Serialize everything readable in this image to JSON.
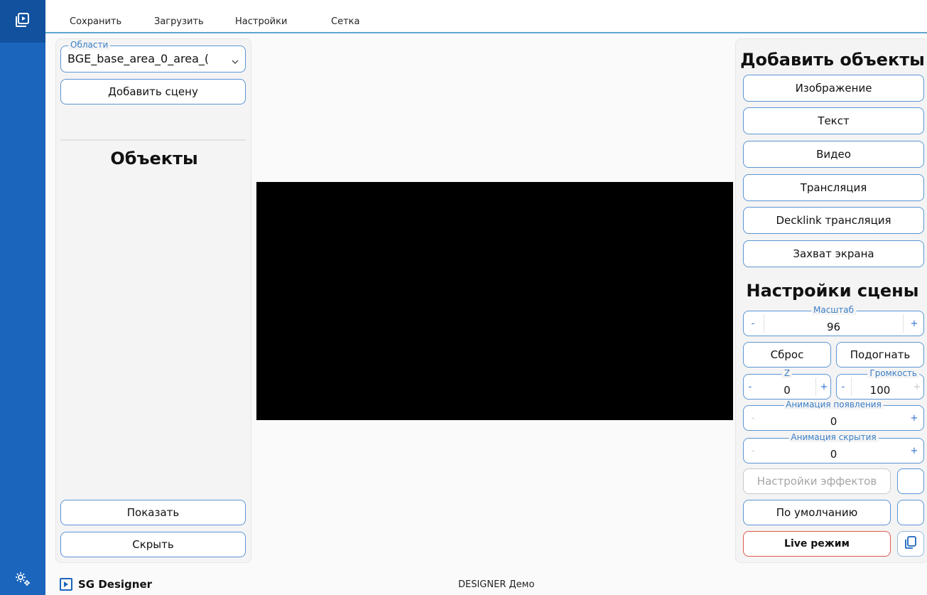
{
  "menu": {
    "save": "Сохранить",
    "load": "Загрузить",
    "settings": "Настройки",
    "grid": "Сетка"
  },
  "left_panel": {
    "areas_legend": "Области",
    "areas_value": "BGE_base_area_0_area_(",
    "add_scene": "Добавить сцену",
    "objects_title": "Объекты",
    "show": "Показать",
    "hide": "Скрыть"
  },
  "right_panel": {
    "add_objects_title": "Добавить объекты",
    "image": "Изображение",
    "text": "Текст",
    "video": "Видео",
    "stream": "Трансляция",
    "decklink": "Decklink трансляция",
    "screen_capture": "Захват экрана",
    "scene_settings_title": "Настройки сцены",
    "scale": {
      "legend": "Масштаб",
      "value": "96"
    },
    "reset": "Сброс",
    "fit": "Подогнать",
    "z": {
      "legend": "Z",
      "value": "0"
    },
    "volume": {
      "legend": "Громкость",
      "value": "100"
    },
    "anim_in": {
      "legend": "Анимация появления",
      "value": "0"
    },
    "anim_out": {
      "legend": "Анимация скрытия",
      "value": "0"
    },
    "effects": "Настройки эффектов",
    "default": "По умолчанию",
    "live": "Live режим"
  },
  "status": {
    "app_name": "SG Designer",
    "center": "DESIGNER Демо"
  },
  "colors": {
    "rail": "#1b65bd",
    "accent": "#5b95d3",
    "live_border": "#e05a4d",
    "menu_underline": "#5fa7cf"
  }
}
